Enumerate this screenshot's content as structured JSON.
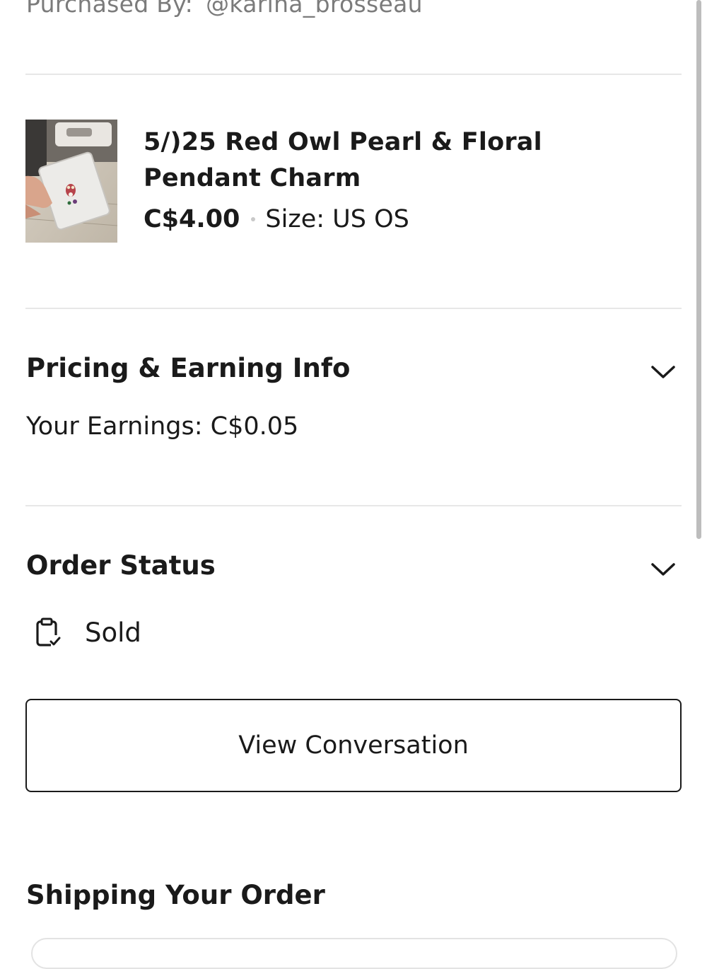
{
  "purchaser": {
    "label": "Purchased By:",
    "username": "@karina_brosseau"
  },
  "item": {
    "title": "5/)25 Red Owl Pearl & Floral Pendant Charm",
    "price": "C$4.00",
    "size": "Size: US OS",
    "image_icon": "owl-pendant-photo"
  },
  "pricing": {
    "title": "Pricing & Earning Info",
    "earnings": "Your Earnings: C$0.05",
    "toggle_icon": "chevron-down-icon"
  },
  "order_status": {
    "title": "Order Status",
    "status": "Sold",
    "status_icon": "clipboard-check-icon",
    "toggle_icon": "chevron-down-icon"
  },
  "actions": {
    "view_conversation": "View Conversation"
  },
  "shipping": {
    "title": "Shipping Your Order"
  }
}
